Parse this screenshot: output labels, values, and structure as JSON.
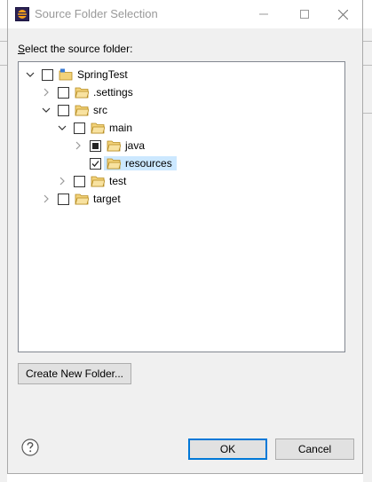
{
  "window": {
    "title": "Source Folder Selection",
    "minimize_icon": "minimize-icon",
    "maximize_icon": "maximize-icon",
    "close_icon": "close-icon"
  },
  "prompt": {
    "mnemonic": "S",
    "rest": "elect the source folder:"
  },
  "tree": {
    "items": [
      {
        "label": "SpringTest",
        "expanded": true,
        "checked": "unchecked",
        "icon": "project-folder-icon"
      },
      {
        "label": ".settings",
        "expanded": false,
        "checked": "unchecked",
        "icon": "folder-icon"
      },
      {
        "label": "src",
        "expanded": true,
        "checked": "unchecked",
        "icon": "folder-icon"
      },
      {
        "label": "main",
        "expanded": true,
        "checked": "unchecked",
        "icon": "folder-icon"
      },
      {
        "label": "java",
        "expanded": false,
        "checked": "partial",
        "icon": "folder-icon"
      },
      {
        "label": "resources",
        "expanded": null,
        "checked": "checked",
        "icon": "folder-icon",
        "selected": true
      },
      {
        "label": "test",
        "expanded": false,
        "checked": "unchecked",
        "icon": "folder-icon"
      },
      {
        "label": "target",
        "expanded": false,
        "checked": "unchecked",
        "icon": "folder-icon"
      }
    ]
  },
  "buttons": {
    "create_new_folder": "Create New Folder...",
    "ok": "OK",
    "cancel": "Cancel",
    "help_icon": "help-icon"
  },
  "colors": {
    "accent": "#0078d7",
    "selection": "#cce8ff",
    "folder": "#e8b84a"
  }
}
